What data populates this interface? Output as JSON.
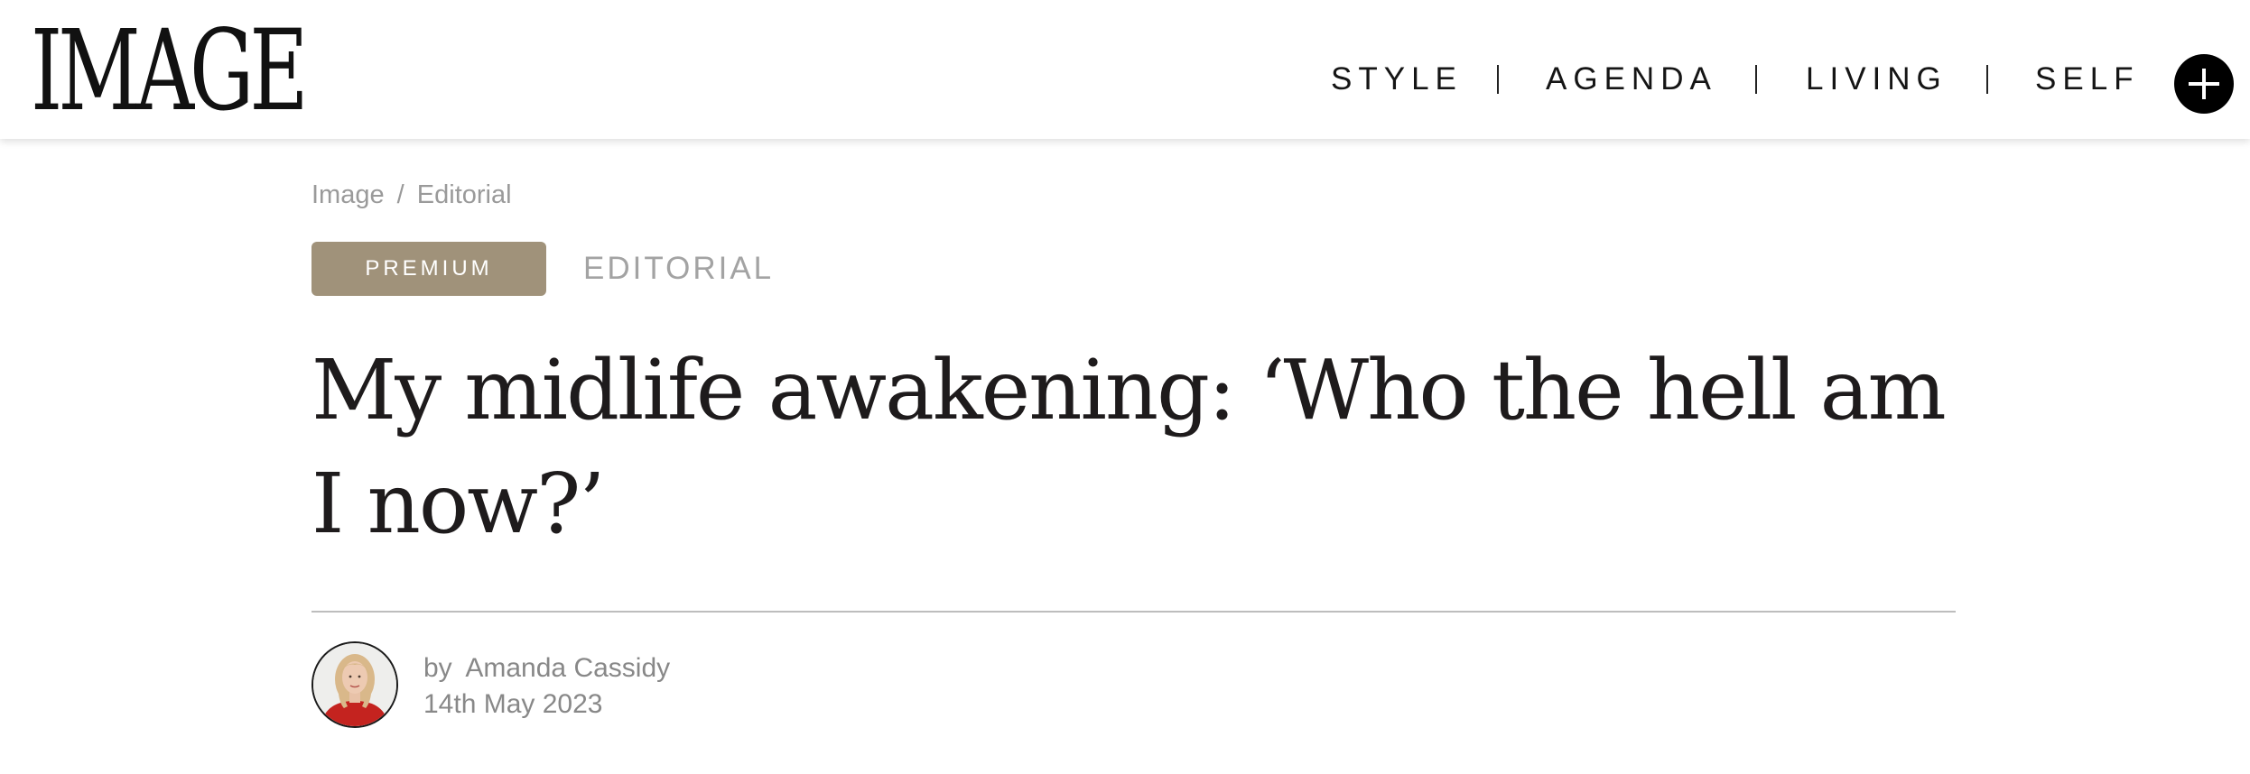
{
  "header": {
    "logo_text": "IMAGE",
    "nav": [
      {
        "label": "STYLE"
      },
      {
        "label": "AGENDA"
      },
      {
        "label": "LIVING"
      },
      {
        "label": "SELF"
      }
    ],
    "plus_icon": "plus-icon"
  },
  "breadcrumb": {
    "root": "Image",
    "separator": "/",
    "current": "Editorial"
  },
  "article": {
    "badge": "PREMIUM",
    "category": "EDITORIAL",
    "title": "My midlife awakening: ‘Who the hell am I now?’",
    "author_prefix": "by",
    "author": "Amanda Cassidy",
    "date": "14th May 2023"
  },
  "colors": {
    "badge_bg": "#a0927a",
    "text_dark": "#1e1b1c",
    "meta_gray": "#888888",
    "plus_button_bg": "#000000"
  }
}
